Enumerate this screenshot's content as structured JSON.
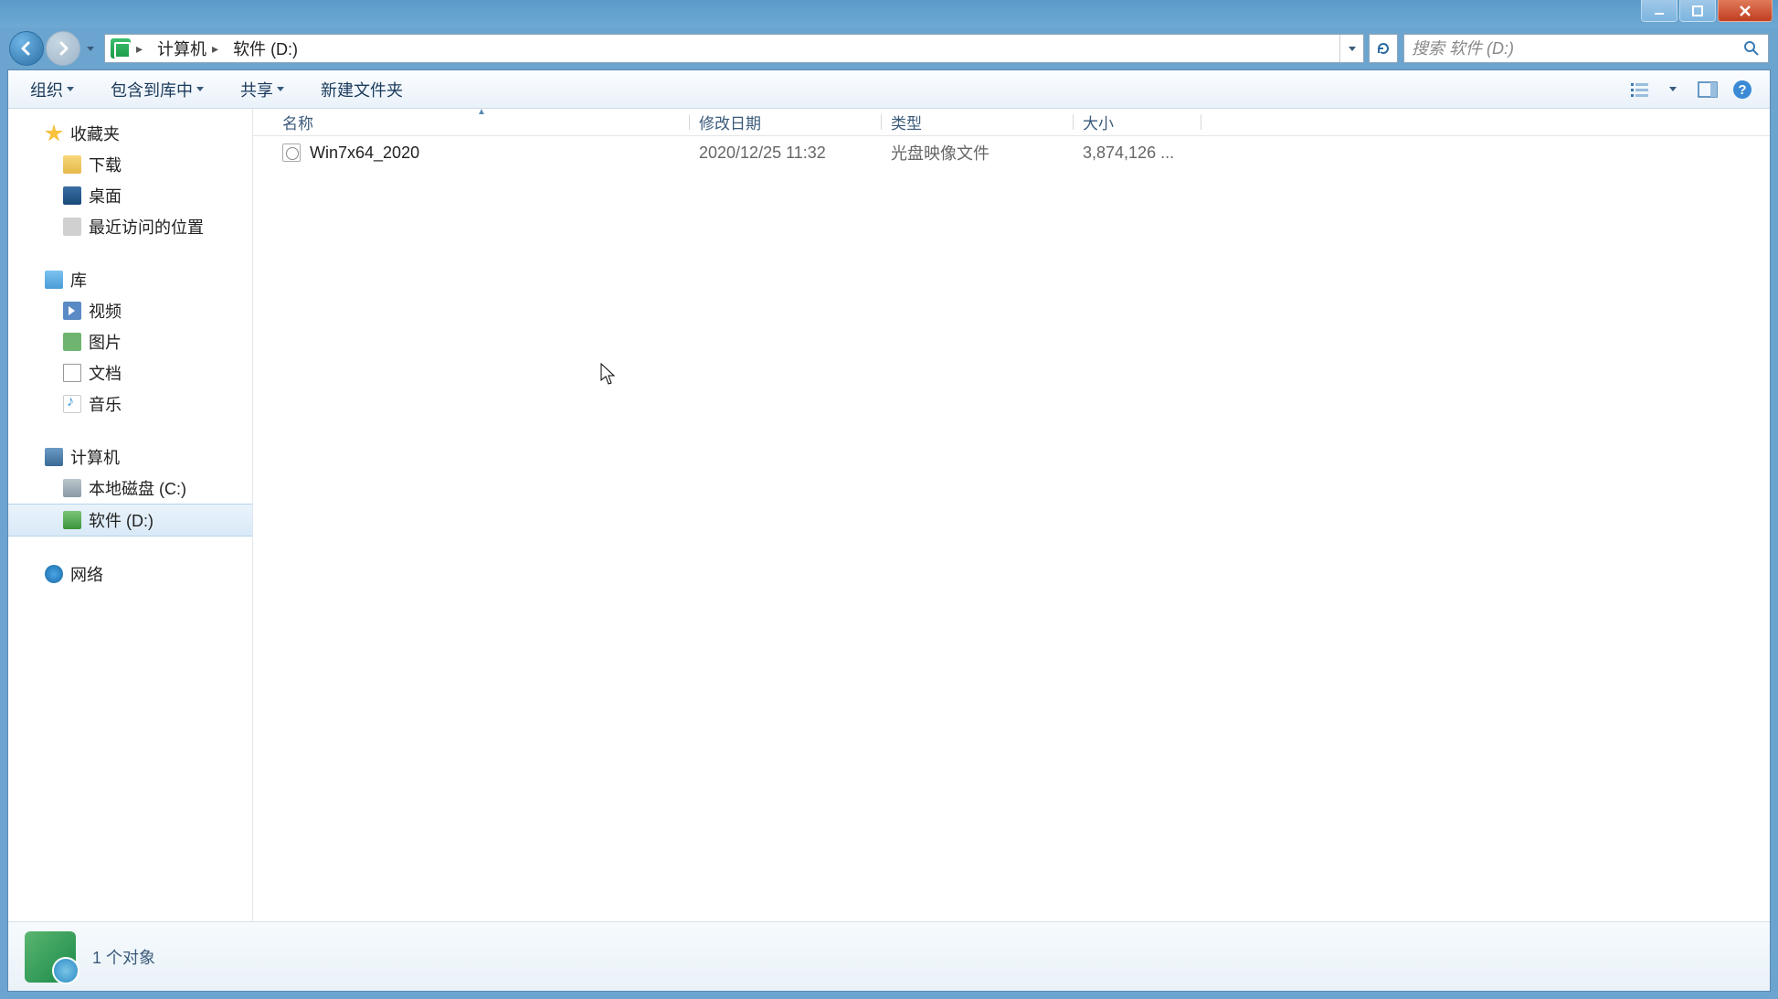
{
  "titlebar": {},
  "address": {
    "segments": [
      "计算机",
      "软件 (D:)"
    ],
    "search_placeholder": "搜索 软件 (D:)"
  },
  "toolbar": {
    "organize": "组织",
    "include": "包含到库中",
    "share": "共享",
    "new_folder": "新建文件夹"
  },
  "sidebar": {
    "favorites": {
      "label": "收藏夹",
      "items": [
        {
          "label": "下载",
          "icon": "folder"
        },
        {
          "label": "桌面",
          "icon": "desktop"
        },
        {
          "label": "最近访问的位置",
          "icon": "recent"
        }
      ]
    },
    "libraries": {
      "label": "库",
      "items": [
        {
          "label": "视频",
          "icon": "video"
        },
        {
          "label": "图片",
          "icon": "pic"
        },
        {
          "label": "文档",
          "icon": "doc"
        },
        {
          "label": "音乐",
          "icon": "music"
        }
      ]
    },
    "computer": {
      "label": "计算机",
      "items": [
        {
          "label": "本地磁盘 (C:)",
          "icon": "drive"
        },
        {
          "label": "软件 (D:)",
          "icon": "drive-g",
          "selected": true
        }
      ]
    },
    "network": {
      "label": "网络"
    }
  },
  "columns": {
    "name": "名称",
    "modified": "修改日期",
    "type": "类型",
    "size": "大小",
    "widths": {
      "name": 456,
      "modified": 210,
      "type": 210,
      "size": 140
    }
  },
  "files": [
    {
      "name": "Win7x64_2020",
      "modified": "2020/12/25 11:32",
      "type": "光盘映像文件",
      "size": "3,874,126 ..."
    }
  ],
  "status": {
    "text": "1 个对象"
  }
}
